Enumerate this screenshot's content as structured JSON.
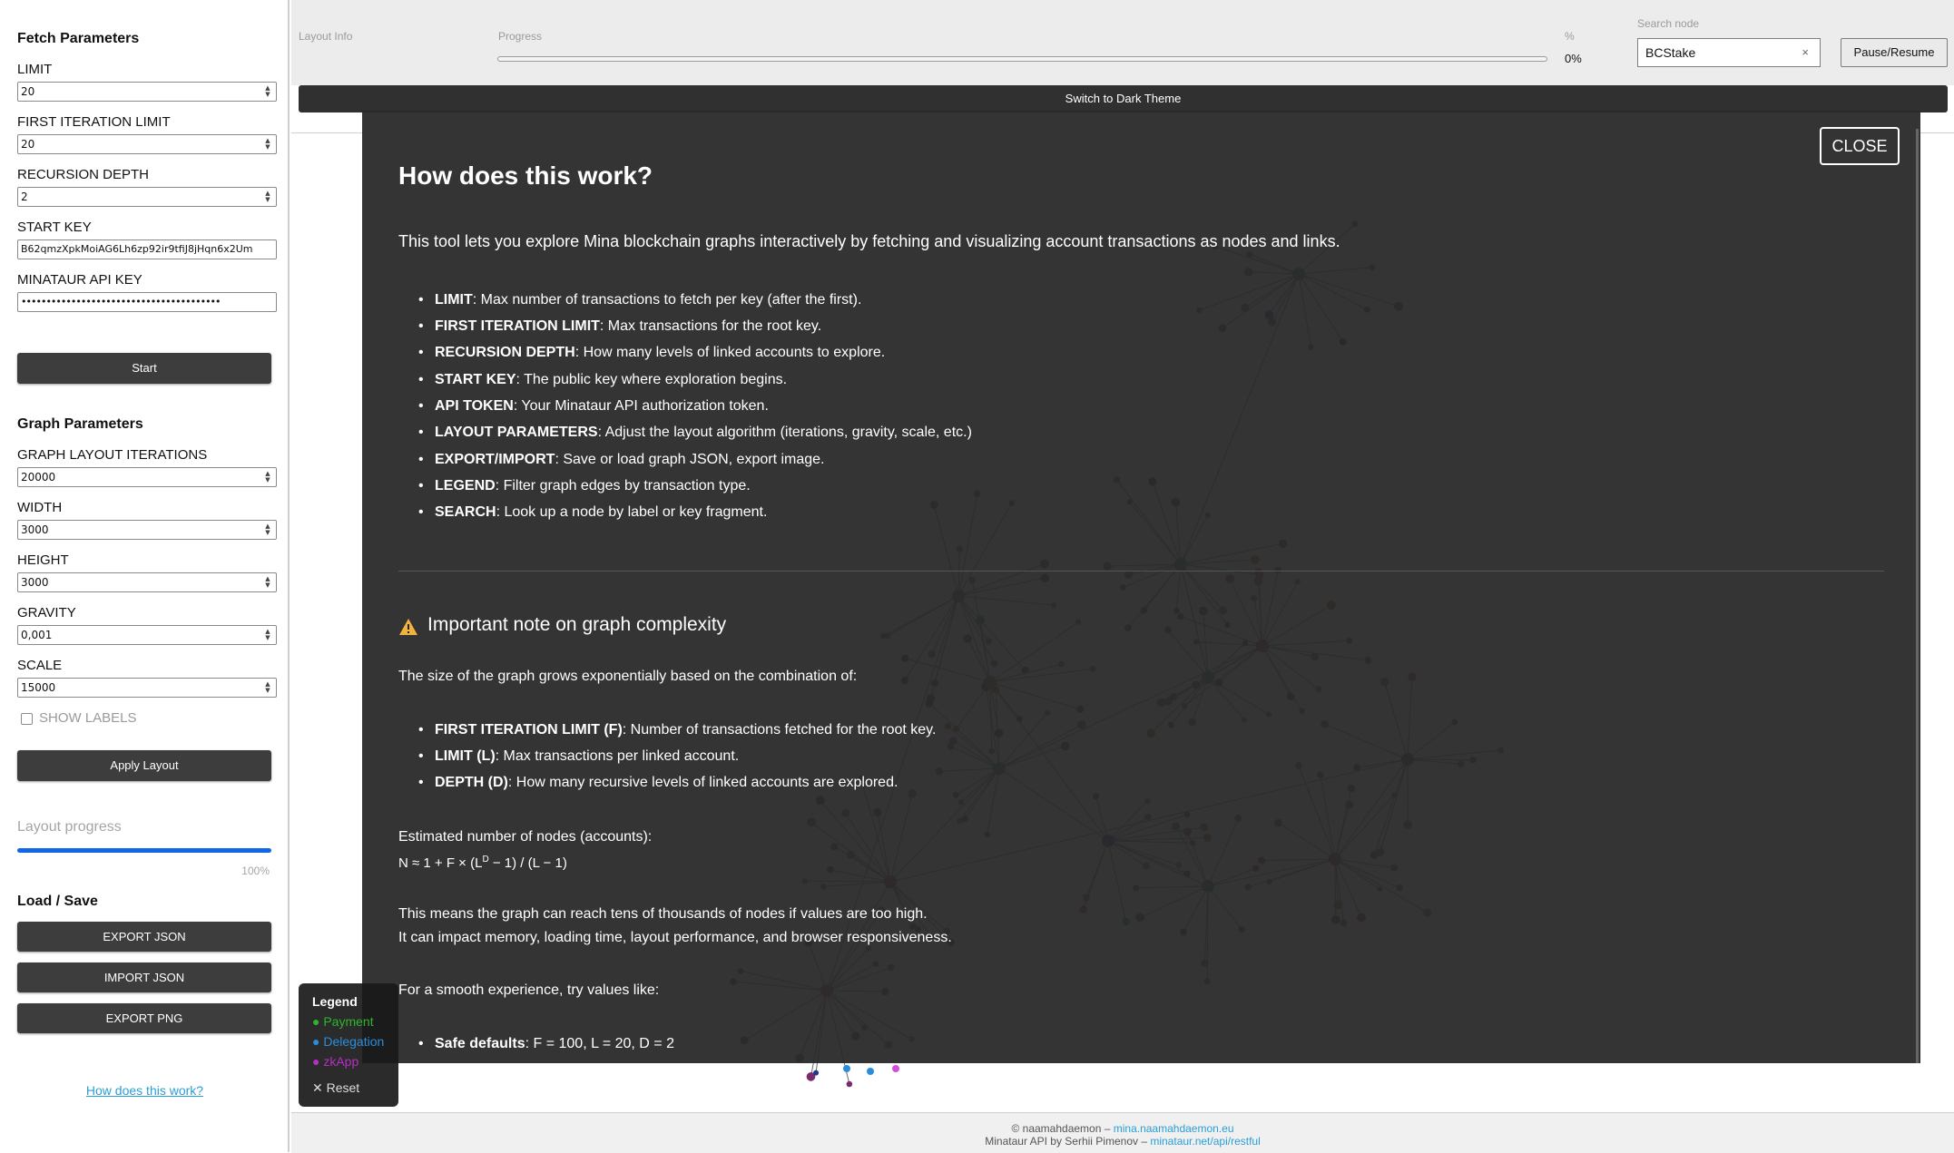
{
  "sidebar": {
    "fetch_title": "Fetch Parameters",
    "limit_label": "LIMIT",
    "limit_value": "20",
    "first_iter_label": "FIRST ITERATION LIMIT",
    "first_iter_value": "20",
    "recursion_label": "RECURSION DEPTH",
    "recursion_value": "2",
    "start_key_label": "START KEY",
    "start_key_value": "B62qmzXpkMoiAG6Lh6zp92ir9tfiJ8jHqn6x2Um",
    "api_key_label": "MINATAUR API KEY",
    "api_key_value": "••••••••••••••••••••••••••••••••••••••••",
    "start_button": "Start",
    "graph_title": "Graph Parameters",
    "iterations_label": "GRAPH LAYOUT ITERATIONS",
    "iterations_value": "20000",
    "width_label": "WIDTH",
    "width_value": "3000",
    "height_label": "HEIGHT",
    "height_value": "3000",
    "gravity_label": "GRAVITY",
    "gravity_value": "0,001",
    "scale_label": "SCALE",
    "scale_value": "15000",
    "show_labels": "SHOW LABELS",
    "show_labels_checked": false,
    "apply_button": "Apply Layout",
    "layout_progress_label": "Layout progress",
    "layout_progress_value": 1.0,
    "layout_progress_text": "100%",
    "load_save_title": "Load / Save",
    "export_json": "EXPORT JSON",
    "import_json": "IMPORT JSON",
    "export_png": "EXPORT PNG",
    "how_link": "How does this work?"
  },
  "topbar": {
    "layout_info_label": "Layout Info",
    "progress_label": "Progress",
    "percent_label": "%",
    "percent_value": "0%",
    "progress_value": 0,
    "search_label": "Search node",
    "search_value": "BCStake",
    "clear_icon": "×",
    "pause_button": "Pause/Resume",
    "theme_button": "Switch to Dark Theme"
  },
  "modal": {
    "close_button": "CLOSE",
    "title": "How does this work?",
    "intro": "This tool lets you explore Mina blockchain graphs interactively by fetching and visualizing account transactions as nodes and links.",
    "items": [
      {
        "term": "LIMIT",
        "desc": ": Max number of transactions to fetch per key (after the first)."
      },
      {
        "term": "FIRST ITERATION LIMIT",
        "desc": ": Max transactions for the root key."
      },
      {
        "term": "RECURSION DEPTH",
        "desc": ": How many levels of linked accounts to explore."
      },
      {
        "term": "START KEY",
        "desc": ": The public key where exploration begins."
      },
      {
        "term": "API TOKEN",
        "desc": ": Your Minataur API authorization token."
      },
      {
        "term": "LAYOUT PARAMETERS",
        "desc": ": Adjust the layout algorithm (iterations, gravity, scale, etc.)"
      },
      {
        "term": "EXPORT/IMPORT",
        "desc": ": Save or load graph JSON, export image."
      },
      {
        "term": "LEGEND",
        "desc": ": Filter graph edges by transaction type."
      },
      {
        "term": "SEARCH",
        "desc": ": Look up a node by label or key fragment."
      }
    ],
    "note_title": "Important note on graph complexity",
    "note_intro": "The size of the graph grows exponentially based on the combination of:",
    "note_items": [
      {
        "term": "FIRST ITERATION LIMIT (F)",
        "desc": ": Number of transactions fetched for the root key."
      },
      {
        "term": "LIMIT (L)",
        "desc": ": Max transactions per linked account."
      },
      {
        "term": "DEPTH (D)",
        "desc": ": How many recursive levels of linked accounts are explored."
      }
    ],
    "estimate_label": "Estimated number of nodes (accounts):",
    "formula_pre": "N ≈ 1 + F × (L",
    "formula_sup": "D",
    "formula_post": " − 1) / (L − 1)",
    "impact_line1": "This means the graph can reach tens of thousands of nodes if values are too high.",
    "impact_line2": "It can impact memory, loading time, layout performance, and browser responsiveness.",
    "smooth_label": "For a smooth experience, try values like:",
    "safe_term": "Safe defaults",
    "safe_desc": ": F = 100, L = 20, D = 2"
  },
  "legend": {
    "title": "Legend",
    "payment": "● Payment",
    "delegation": "● Delegation",
    "zkapp": "● zkApp",
    "reset": "✕ Reset",
    "colors": {
      "payment": "#2db52d",
      "delegation": "#2a8ddb",
      "zkapp": "#b52fc4"
    }
  },
  "footer": {
    "line1_prefix": "© naamahdaemon – ",
    "line1_link": "mina.naamahdaemon.eu",
    "line2_prefix": "Minataur API by Serhii Pimenov – ",
    "line2_link": "minataur.net/api/restful"
  }
}
